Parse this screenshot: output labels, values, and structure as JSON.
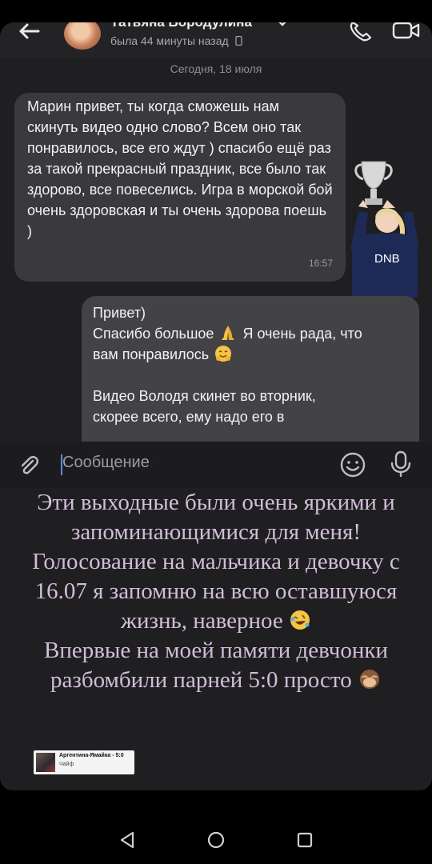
{
  "header": {
    "contact_name": "Татьяна Бородулина",
    "last_seen": "была 44 минуты назад"
  },
  "chat": {
    "date_separator": "Сегодня, 18 июля",
    "incoming": {
      "text": "Марин привет, ты когда сможешь нам скинуть видео одно слово? Всем оно так понравилось, все его ждут ) спасибо ещё раз за такой прекрасный праздник, все было так здорово, все повеселись. Игра в морской бой очень здоровская и ты очень здорова поешь )",
      "time": "16:57"
    },
    "sticker": {
      "jersey_text": "DNB"
    },
    "outgoing": {
      "line1": "Привет)",
      "line2_before_emoji": "Спасибо большое",
      "line2_after_emoji": "Я очень рада, что",
      "line3": "вам понравилось",
      "line4": "Видео Володя скинет во вторник,",
      "line5": "скорее всего, ему надо его в"
    }
  },
  "composer": {
    "placeholder": "Сообщение"
  },
  "caption": {
    "line1": "Эти выходные были очень яркими и",
    "line2": "запоминающимися для меня!",
    "line3": "Голосование на мальчика и девочку с",
    "line4": "16.07 я запомню на всю оставшуюся",
    "line5": "жизнь, наверное",
    "line6": "Впервые на моей памяти девчонки",
    "line7": "разбомбили парней 5:0 просто"
  },
  "music": {
    "title": "Аргентина-Ямайка - 5:0",
    "artist": "Чайф"
  },
  "icons": {
    "back": "arrow-left-icon",
    "call": "phone-icon",
    "video": "video-camera-icon",
    "attach": "paperclip-icon",
    "emoji": "smile-icon",
    "voice": "microphone-icon"
  },
  "colors": {
    "background": "#1f1f21",
    "incoming_bubble": "#3a3a3c",
    "outgoing_bubble": "#434345",
    "caption_text": "#d2bdd8",
    "caret": "#5b8cff"
  }
}
